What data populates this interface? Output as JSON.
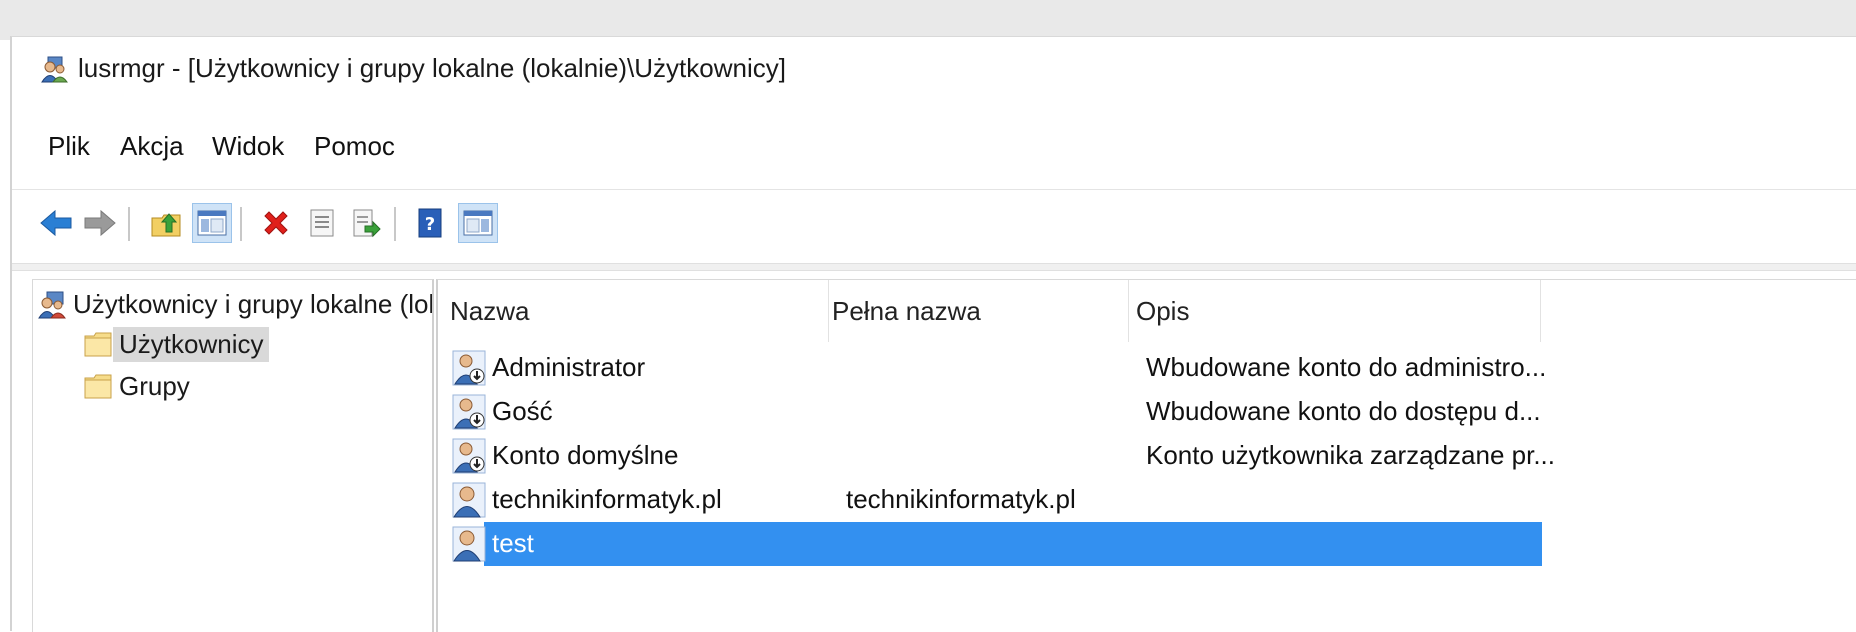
{
  "window": {
    "title": "lusrmgr - [Użytkownicy i grupy lokalne (lokalnie)\\Użytkownicy]"
  },
  "menu": [
    {
      "label": "Plik"
    },
    {
      "label": "Akcja"
    },
    {
      "label": "Widok"
    },
    {
      "label": "Pomoc"
    }
  ],
  "toolbar": {
    "buttons": [
      "back-icon",
      "forward-icon",
      "up-folder-icon",
      "show-hide-tree-icon",
      "delete-icon",
      "properties-icon",
      "export-list-icon",
      "help-icon",
      "show-hide-action-pane-icon"
    ],
    "delete_color": "#e0201b",
    "back_color": "#2a7fd4"
  },
  "tree": {
    "root": "Użytkownicy i grupy lokalne (lokalnie)",
    "children": [
      {
        "label": "Użytkownicy",
        "selected": true
      },
      {
        "label": "Grupy",
        "selected": false
      }
    ]
  },
  "list": {
    "columns": [
      "Nazwa",
      "Pełna nazwa",
      "Opis"
    ],
    "rows": [
      {
        "name": "Administrator",
        "full_name": "",
        "description": "Wbudowane konto do administro...",
        "disabled": true,
        "selected": false
      },
      {
        "name": "Gość",
        "full_name": "",
        "description": "Wbudowane konto do dostępu d...",
        "disabled": true,
        "selected": false
      },
      {
        "name": "Konto domyślne",
        "full_name": "",
        "description": "Konto użytkownika zarządzane pr...",
        "disabled": true,
        "selected": false
      },
      {
        "name": "technikinformatyk.pl",
        "full_name": "technikinformatyk.pl",
        "description": "",
        "disabled": false,
        "selected": false
      },
      {
        "name": "test",
        "full_name": "",
        "description": "",
        "disabled": false,
        "selected": true
      }
    ],
    "selection_color": "#3390f0"
  }
}
